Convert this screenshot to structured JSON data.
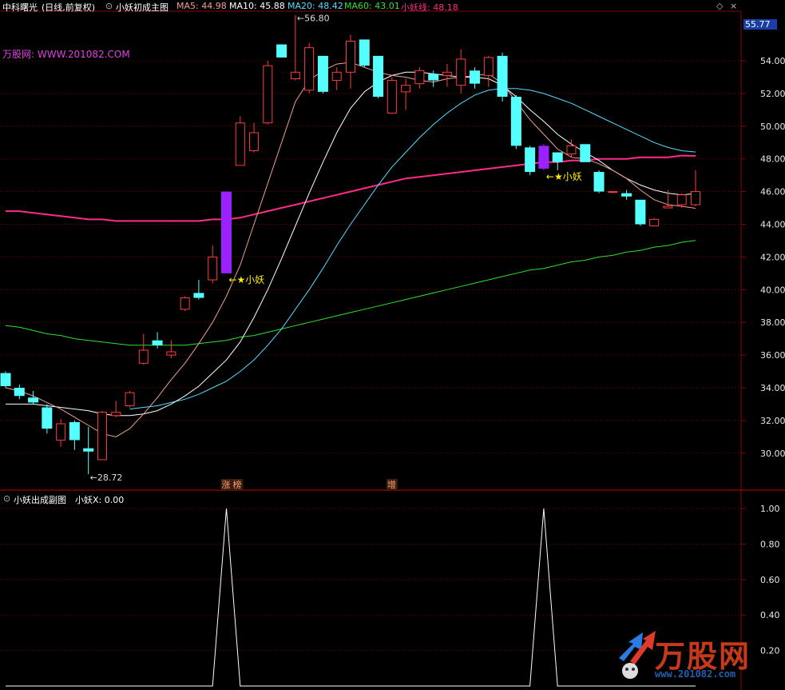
{
  "header": {
    "stock": "中科曙光",
    "mode": "(日线,前复权)",
    "main_indicator": "小妖初成主图",
    "ma5": "MA5: 44.98",
    "ma10": "MA10: 45.88",
    "ma20": "MA20: 48.42",
    "ma60": "MA60: 43.01",
    "line": "小妖线: 48.18",
    "site": "万股网: WWW.201082.COM",
    "current_price": "55.77",
    "sub_indicator": "小妖出成副图",
    "sub_value": "小妖X: 0.00"
  },
  "colors": {
    "up": "#ff3c3c",
    "down": "#55ffff",
    "ma5": "#f0a090",
    "ma10": "#ffffff",
    "ma20": "#55dcff",
    "ma60": "#30e030",
    "yao": "#ff2a8a",
    "signal": "#9b22ff",
    "grid": "#8a0000"
  },
  "badges": {
    "zhang": "涨",
    "bang": "榜",
    "zeng": "增"
  },
  "watermark": {
    "text": "万股网",
    "url": "www.201082.com"
  },
  "chart_data": [
    {
      "type": "candlestick",
      "title": "小妖初成主图",
      "ylim": [
        28.0,
        56.8
      ],
      "y_ticks": [
        "54.00",
        "52.00",
        "50.00",
        "48.00",
        "46.00",
        "44.00",
        "42.00",
        "40.00",
        "38.00",
        "36.00",
        "34.00",
        "32.00",
        "30.00"
      ],
      "candles": [
        {
          "o": 34.9,
          "h": 35.0,
          "l": 34.0,
          "c": 34.1
        },
        {
          "o": 34.0,
          "h": 34.2,
          "l": 33.3,
          "c": 33.5
        },
        {
          "o": 33.4,
          "h": 33.8,
          "l": 33.0,
          "c": 33.1
        },
        {
          "o": 32.8,
          "h": 33.0,
          "l": 31.2,
          "c": 31.5
        },
        {
          "o": 30.8,
          "h": 32.1,
          "l": 30.4,
          "c": 31.8
        },
        {
          "o": 31.9,
          "h": 32.0,
          "l": 30.2,
          "c": 30.8
        },
        {
          "o": 30.3,
          "h": 31.6,
          "l": 28.72,
          "c": 30.1
        },
        {
          "o": 29.6,
          "h": 32.6,
          "l": 29.6,
          "c": 32.5
        },
        {
          "o": 32.3,
          "h": 33.2,
          "l": 32.2,
          "c": 32.5
        },
        {
          "o": 32.9,
          "h": 33.8,
          "l": 32.8,
          "c": 33.7
        },
        {
          "o": 35.5,
          "h": 37.3,
          "l": 35.4,
          "c": 36.3
        },
        {
          "o": 36.9,
          "h": 37.4,
          "l": 36.4,
          "c": 36.6
        },
        {
          "o": 36.0,
          "h": 36.9,
          "l": 35.8,
          "c": 36.2
        },
        {
          "o": 38.8,
          "h": 39.6,
          "l": 38.7,
          "c": 39.5
        },
        {
          "o": 39.8,
          "h": 40.6,
          "l": 39.4,
          "c": 39.5
        },
        {
          "o": 40.6,
          "h": 42.7,
          "l": 40.4,
          "c": 42.0
        },
        {
          "o": 46.0,
          "h": 46.0,
          "l": 41.0,
          "c": 41.0,
          "signal": true
        },
        {
          "o": 47.6,
          "h": 50.6,
          "l": 47.6,
          "c": 50.2
        },
        {
          "o": 48.5,
          "h": 50.2,
          "l": 48.4,
          "c": 49.6
        },
        {
          "o": 50.2,
          "h": 54.0,
          "l": 50.1,
          "c": 53.7
        },
        {
          "o": 55.0,
          "h": 55.0,
          "l": 54.2,
          "c": 54.2
        },
        {
          "o": 52.9,
          "h": 56.8,
          "l": 52.8,
          "c": 53.3
        },
        {
          "o": 52.2,
          "h": 55.1,
          "l": 52.0,
          "c": 54.8
        },
        {
          "o": 54.3,
          "h": 54.3,
          "l": 52.0,
          "c": 52.1
        },
        {
          "o": 52.8,
          "h": 53.6,
          "l": 52.2,
          "c": 53.3
        },
        {
          "o": 53.3,
          "h": 55.6,
          "l": 52.3,
          "c": 55.2
        },
        {
          "o": 55.3,
          "h": 55.3,
          "l": 53.6,
          "c": 53.7
        },
        {
          "o": 54.3,
          "h": 54.3,
          "l": 51.7,
          "c": 51.8
        },
        {
          "o": 50.8,
          "h": 53.0,
          "l": 50.8,
          "c": 52.8
        },
        {
          "o": 52.1,
          "h": 52.9,
          "l": 51.0,
          "c": 52.5
        },
        {
          "o": 52.6,
          "h": 53.6,
          "l": 52.3,
          "c": 53.4
        },
        {
          "o": 53.2,
          "h": 53.4,
          "l": 52.4,
          "c": 52.8
        },
        {
          "o": 53.1,
          "h": 53.8,
          "l": 52.4,
          "c": 53.3
        },
        {
          "o": 52.5,
          "h": 54.7,
          "l": 52.0,
          "c": 54.1
        },
        {
          "o": 53.4,
          "h": 53.6,
          "l": 52.3,
          "c": 52.6
        },
        {
          "o": 53.1,
          "h": 54.3,
          "l": 52.4,
          "c": 54.2
        },
        {
          "o": 54.3,
          "h": 54.5,
          "l": 51.5,
          "c": 51.8
        },
        {
          "o": 51.8,
          "h": 51.9,
          "l": 48.6,
          "c": 48.8
        },
        {
          "o": 48.7,
          "h": 48.8,
          "l": 47.0,
          "c": 47.2
        },
        {
          "o": 47.4,
          "h": 48.9,
          "l": 47.3,
          "c": 48.8,
          "signal": true
        },
        {
          "o": 48.4,
          "h": 48.4,
          "l": 47.3,
          "c": 47.8
        },
        {
          "o": 48.3,
          "h": 49.2,
          "l": 48.1,
          "c": 48.8
        },
        {
          "o": 48.9,
          "h": 48.9,
          "l": 47.8,
          "c": 47.8
        },
        {
          "o": 47.2,
          "h": 47.3,
          "l": 45.9,
          "c": 46.0
        },
        {
          "o": 46.0,
          "h": 46.0,
          "l": 45.9,
          "c": 46.0
        },
        {
          "o": 45.9,
          "h": 46.1,
          "l": 45.5,
          "c": 45.7
        },
        {
          "o": 45.5,
          "h": 45.5,
          "l": 43.9,
          "c": 44.0
        },
        {
          "o": 43.9,
          "h": 44.4,
          "l": 43.9,
          "c": 44.3
        },
        {
          "o": 45.0,
          "h": 46.1,
          "l": 45.0,
          "c": 45.1
        },
        {
          "o": 45.2,
          "h": 45.9,
          "l": 45.0,
          "c": 45.8
        },
        {
          "o": 45.2,
          "h": 47.3,
          "l": 45.1,
          "c": 46.0
        }
      ],
      "ma5": [
        34.0,
        33.8,
        33.5,
        33.1,
        32.7,
        32.2,
        31.7,
        31.2,
        31.0,
        31.5,
        32.4,
        33.4,
        34.5,
        35.5,
        36.7,
        38.0,
        39.6,
        41.5,
        44.0,
        46.5,
        49.0,
        51.5,
        52.8,
        53.4,
        53.8,
        53.9,
        53.6,
        53.3,
        53.1,
        53.0,
        52.8,
        52.7,
        52.9,
        53.0,
        53.1,
        53.2,
        52.6,
        51.5,
        50.4,
        49.5,
        48.6,
        48.1,
        48.0,
        47.7,
        47.3,
        46.8,
        46.1,
        45.5,
        45.2,
        45.1,
        44.98
      ],
      "ma10": [
        33.0,
        33.0,
        33.0,
        32.9,
        32.8,
        32.7,
        32.6,
        32.4,
        32.3,
        32.3,
        32.4,
        32.6,
        33.0,
        33.5,
        34.1,
        34.9,
        35.7,
        36.8,
        38.3,
        40.0,
        41.9,
        43.9,
        45.9,
        47.8,
        49.6,
        51.1,
        52.1,
        52.7,
        53.1,
        53.3,
        53.3,
        53.2,
        53.1,
        53.0,
        53.0,
        52.9,
        52.5,
        51.8,
        51.0,
        50.3,
        49.5,
        48.9,
        48.4,
        47.9,
        47.3,
        46.8,
        46.4,
        46.1,
        45.9,
        45.8,
        45.88
      ],
      "ma20": [
        null,
        null,
        null,
        null,
        null,
        null,
        null,
        null,
        null,
        32.7,
        32.8,
        32.9,
        33.1,
        33.3,
        33.6,
        34.0,
        34.4,
        35.0,
        35.7,
        36.6,
        37.6,
        38.8,
        40.0,
        41.3,
        42.7,
        44.0,
        45.2,
        46.4,
        47.5,
        48.4,
        49.3,
        50.1,
        50.8,
        51.4,
        51.9,
        52.2,
        52.3,
        52.3,
        52.2,
        52.0,
        51.7,
        51.4,
        51.0,
        50.6,
        50.2,
        49.8,
        49.4,
        49.0,
        48.7,
        48.5,
        48.42
      ],
      "ma60": [
        37.8,
        37.7,
        37.5,
        37.3,
        37.2,
        37.0,
        36.9,
        36.8,
        36.7,
        36.6,
        36.6,
        36.6,
        36.6,
        36.6,
        36.7,
        36.8,
        36.9,
        37.1,
        37.2,
        37.4,
        37.6,
        37.8,
        38.0,
        38.2,
        38.4,
        38.6,
        38.8,
        39.0,
        39.2,
        39.4,
        39.6,
        39.8,
        40.0,
        40.2,
        40.4,
        40.6,
        40.8,
        41.0,
        41.2,
        41.3,
        41.5,
        41.7,
        41.8,
        42.0,
        42.1,
        42.3,
        42.4,
        42.6,
        42.7,
        42.9,
        43.01
      ],
      "yao_line": [
        44.8,
        44.8,
        44.7,
        44.6,
        44.5,
        44.4,
        44.3,
        44.3,
        44.2,
        44.2,
        44.2,
        44.2,
        44.2,
        44.2,
        44.2,
        44.3,
        44.3,
        44.4,
        44.6,
        44.8,
        45.0,
        45.2,
        45.4,
        45.6,
        45.8,
        46.0,
        46.2,
        46.4,
        46.6,
        46.8,
        46.9,
        47.0,
        47.1,
        47.2,
        47.3,
        47.4,
        47.5,
        47.6,
        47.7,
        47.8,
        47.8,
        47.9,
        47.9,
        48.0,
        48.0,
        48.0,
        48.1,
        48.1,
        48.1,
        48.2,
        48.18
      ],
      "annotations": {
        "high": "56.80",
        "low": "28.72",
        "signal_label": "←★小妖"
      }
    },
    {
      "type": "line",
      "title": "小妖出成副图",
      "ylim": [
        0,
        1.0
      ],
      "y_ticks": [
        "1.00",
        "0.80",
        "0.60",
        "0.40",
        "0.20"
      ],
      "series": [
        {
          "name": "小妖X",
          "values": [
            0,
            0,
            0,
            0,
            0,
            0,
            0,
            0,
            0,
            0,
            0,
            0,
            0,
            0,
            0,
            0,
            1,
            0,
            0,
            0,
            0,
            0,
            0,
            0,
            0,
            0,
            0,
            0,
            0,
            0,
            0,
            0,
            0,
            0,
            0,
            0,
            0,
            0,
            0,
            1,
            0,
            0,
            0,
            0,
            0,
            0,
            0,
            0,
            0,
            0,
            0
          ]
        }
      ]
    }
  ]
}
